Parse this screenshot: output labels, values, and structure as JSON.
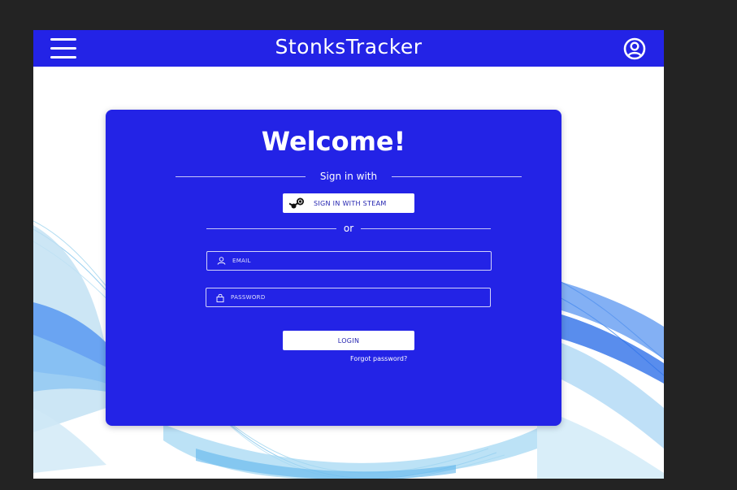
{
  "header": {
    "title": "StonksTracker",
    "menu_icon": "hamburger-menu-icon",
    "account_icon": "user-circle-icon",
    "background": "#2323e6"
  },
  "login_card": {
    "welcome": "Welcome!",
    "sign_in_with": "Sign in with",
    "steam_button": "SIGN IN WITH STEAM",
    "steam_icon": "steam-logo-icon",
    "or": "or",
    "email_placeholder": "EMAIL",
    "email_icon": "user-icon",
    "password_placeholder": "PASSWORD",
    "password_icon": "lock-icon",
    "login_button": "LOGIN",
    "forgot_password": "Forgot password?",
    "background": "#2323e6"
  }
}
